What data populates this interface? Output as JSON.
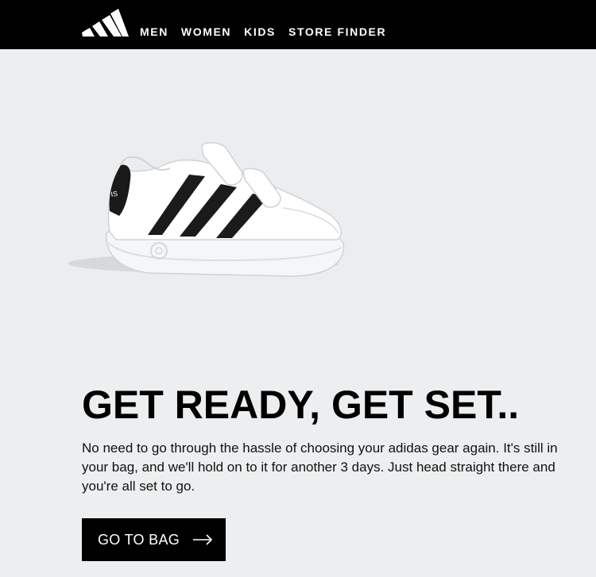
{
  "header": {
    "logo_icon": "adidas-logo-icon",
    "nav": [
      {
        "label": "MEN"
      },
      {
        "label": "WOMEN"
      },
      {
        "label": "KIDS"
      },
      {
        "label": "STORE FINDER"
      }
    ]
  },
  "hero": {
    "image_icon": "sneaker-product-image"
  },
  "content": {
    "headline": "GET READY, GET SET..",
    "body": "No need to go through the hassle of choosing your adidas gear again. It's still in your bag, and we'll hold on to it for another 3 days. Just head straight there and you're all set to go."
  },
  "cta": {
    "label": "GO TO BAG",
    "icon": "arrow-right-icon"
  },
  "colors": {
    "header_bg": "#000000",
    "page_bg": "#eceeef",
    "button_bg": "#000000",
    "text": "#000000"
  }
}
